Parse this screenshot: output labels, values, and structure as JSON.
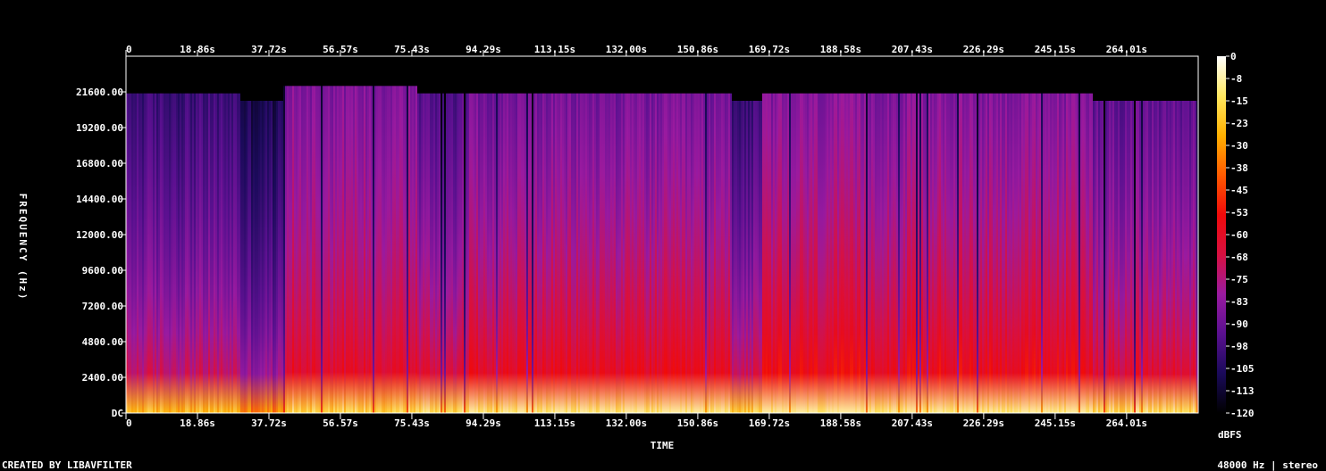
{
  "chart_data": {
    "type": "heatmap",
    "title": "",
    "xlabel": "TIME",
    "ylabel": "FREQUENCY (Hz)",
    "x_ticks": [
      "0",
      "18.86s",
      "37.72s",
      "56.57s",
      "75.43s",
      "94.29s",
      "113.15s",
      "132.00s",
      "150.86s",
      "169.72s",
      "188.58s",
      "207.43s",
      "226.29s",
      "245.15s",
      "264.01s"
    ],
    "x_tick_values": [
      0,
      18.86,
      37.72,
      56.57,
      75.43,
      94.29,
      113.15,
      132.0,
      150.86,
      169.72,
      188.58,
      207.43,
      226.29,
      245.15,
      264.01
    ],
    "xlim": [
      0,
      282.9
    ],
    "y_ticks": [
      "DC",
      "2400.00",
      "4800.00",
      "7200.00",
      "9600.00",
      "12000.00",
      "14400.00",
      "16800.00",
      "19200.00",
      "21600.00"
    ],
    "y_tick_values": [
      0,
      2400,
      4800,
      7200,
      9600,
      12000,
      14400,
      16800,
      19200,
      21600
    ],
    "ylim": [
      0,
      24000
    ],
    "colorbar": {
      "label": "dBFS",
      "ticks": [
        "0",
        "-8",
        "-15",
        "-23",
        "-30",
        "-38",
        "-45",
        "-53",
        "-60",
        "-68",
        "-75",
        "-83",
        "-90",
        "-98",
        "-105",
        "-113",
        "-120"
      ],
      "tick_values": [
        0,
        -7.5,
        -15,
        -22.5,
        -30,
        -37.5,
        -45,
        -52.5,
        -60,
        -67.5,
        -75,
        -82.5,
        -90,
        -97.5,
        -105,
        -112.5,
        -120
      ],
      "range": [
        -120,
        0
      ],
      "colors": [
        "#000000",
        "#1a0a5a",
        "#5a1090",
        "#9a1aa0",
        "#d81040",
        "#f00a0a",
        "#ff5a00",
        "#ffb000",
        "#ffe860",
        "#ffffff"
      ]
    },
    "segments": [
      {
        "t_start": 0,
        "t_end": 30,
        "low_db": -45,
        "high_db": -100,
        "cutoff_hz": 21500
      },
      {
        "t_start": 30,
        "t_end": 41.5,
        "low_db": -55,
        "high_db": -108,
        "cutoff_hz": 21000
      },
      {
        "t_start": 41.5,
        "t_end": 77,
        "low_db": -38,
        "high_db": -85,
        "cutoff_hz": 22000
      },
      {
        "t_start": 77,
        "t_end": 90,
        "low_db": -36,
        "high_db": -95,
        "cutoff_hz": 21500
      },
      {
        "t_start": 90,
        "t_end": 160,
        "low_db": -32,
        "high_db": -88,
        "cutoff_hz": 21500
      },
      {
        "t_start": 160,
        "t_end": 168,
        "low_db": -40,
        "high_db": -100,
        "cutoff_hz": 21000
      },
      {
        "t_start": 168,
        "t_end": 255,
        "low_db": -30,
        "high_db": -85,
        "cutoff_hz": 21500
      },
      {
        "t_start": 255,
        "t_end": 282.9,
        "low_db": -36,
        "high_db": -92,
        "cutoff_hz": 21000
      }
    ]
  },
  "footer": {
    "credit": "CREATED BY LIBAVFILTER",
    "info": "48000 Hz | stereo"
  }
}
